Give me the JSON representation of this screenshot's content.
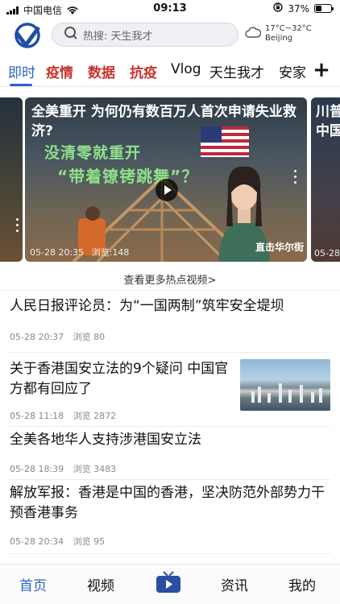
{
  "status": {
    "carrier": "中国电信",
    "time": "09:13",
    "battery": "37%"
  },
  "header": {
    "search_placeholder": "热搜: 天生我才",
    "weather_temp": "17°C~32°C",
    "weather_city": "Beijing"
  },
  "tabs": [
    "即时",
    "疫情",
    "数据",
    "抗疫",
    "Vlog",
    "天生我才",
    "安家"
  ],
  "carousel": {
    "left_meta": "",
    "main": {
      "title": "全美重开 为何仍有数百万人首次申请失业救济?",
      "overlay_line1": "没清零就重开",
      "overlay_line2": "“带着镣铐跳舞”？",
      "date": "05-28 20:35",
      "views": "浏览:148",
      "brand": "直击华尔街"
    },
    "right": {
      "title": "川普中国",
      "date": "05-28"
    }
  },
  "more_link": "查看更多热点视频>",
  "news": [
    {
      "title": "人民日报评论员：为“一国两制”筑牢安全堤坝",
      "date": "05-28 20:37",
      "views": "浏览 80"
    },
    {
      "title": "关于香港国安立法的9个疑问 中国官方都有回应了",
      "date": "05-28 11:18",
      "views": "浏览 2872"
    },
    {
      "title": "全美各地华人支持涉港国安立法",
      "date": "05-28 18:39",
      "views": "浏览 3483"
    },
    {
      "title": "解放军报：香港是中国的香港，坚决防范外部势力干预香港事务",
      "date": "05-28 20:34",
      "views": "浏览 95"
    }
  ],
  "bottom_nav": [
    "首页",
    "视频",
    "资讯",
    "我的"
  ],
  "colors": {
    "accent": "#2a63c7",
    "highlight": "#c8322c"
  }
}
